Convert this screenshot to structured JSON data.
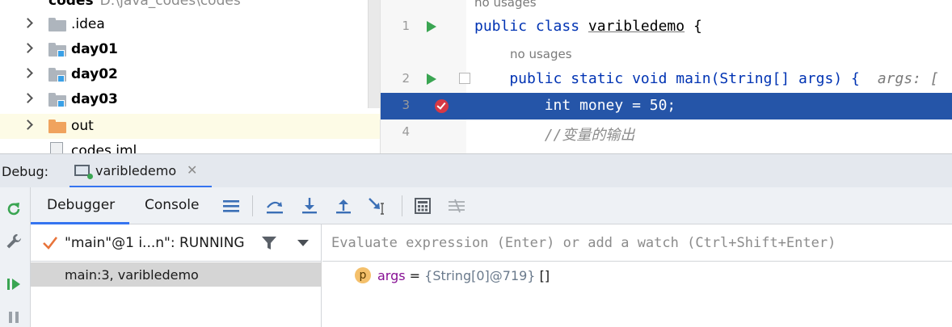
{
  "project_tree": {
    "root": {
      "name": "codes",
      "path": "D:\\java_codes\\codes"
    },
    "items": [
      {
        "label": ".idea",
        "bold": false,
        "kind": "folder"
      },
      {
        "label": "day01",
        "bold": true,
        "kind": "module"
      },
      {
        "label": "day02",
        "bold": true,
        "kind": "module"
      },
      {
        "label": "day03",
        "bold": true,
        "kind": "module"
      },
      {
        "label": "out",
        "bold": false,
        "kind": "excluded-folder"
      },
      {
        "label": "codes.iml",
        "bold": false,
        "kind": "file"
      }
    ]
  },
  "editor": {
    "hint_no_usages": "no usages",
    "lines": [
      {
        "number": "1",
        "pre": "public class ",
        "name": "varibledemo",
        "post": " {"
      },
      {
        "number": "2",
        "text": "    public static void main(String[] args) {",
        "inlay": "args: ["
      },
      {
        "number": "3",
        "text": "        int money = 50;"
      },
      {
        "number": "4",
        "text": "        //变量的输出"
      }
    ]
  },
  "debug": {
    "label": "Debug:",
    "session_tab": "varibledemo",
    "tabs": [
      "Debugger",
      "Console"
    ],
    "thread": "\"main\"@1 i...n\": RUNNING",
    "frame": "main:3, varibledemo",
    "evaluate_placeholder": "Evaluate expression (Enter) or add a watch (Ctrl+Shift+Enter)",
    "variable": {
      "badge": "p",
      "name": "args",
      "eq": " = ",
      "type": "{String[0]@719}",
      "value": " []"
    }
  },
  "colors": {
    "current_line": "#2555a8",
    "keyword": "#0033b3",
    "run_green": "#3aa552",
    "breakpoint_red": "#d63845",
    "accent_blue": "#3574f0"
  }
}
